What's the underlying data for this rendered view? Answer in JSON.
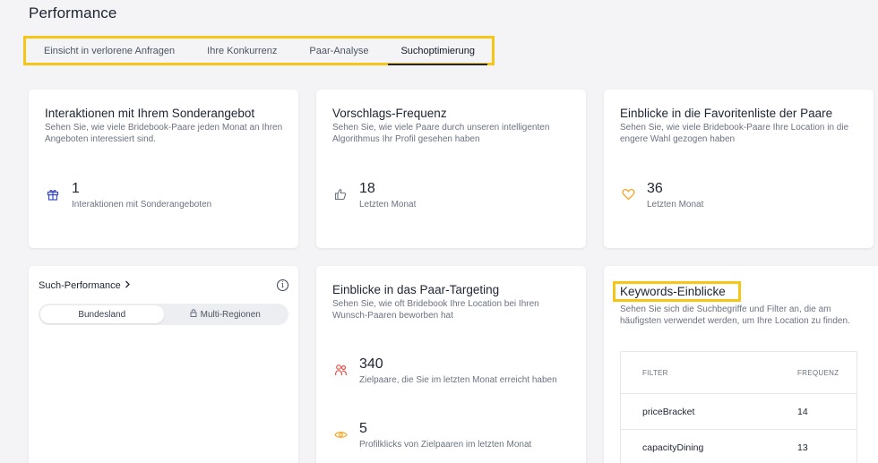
{
  "page": {
    "title": "Performance"
  },
  "tabs": [
    {
      "label": "Einsicht in verlorene Anfragen"
    },
    {
      "label": "Ihre Konkurrenz"
    },
    {
      "label": "Paar-Analyse"
    },
    {
      "label": "Suchoptimierung"
    }
  ],
  "cards": {
    "offer": {
      "title": "Interaktionen mit Ihrem Sonderangebot",
      "description": "Sehen Sie, wie viele Bridebook-Paare jeden Monat an Ihren Angeboten interessiert sind.",
      "metric_value": "1",
      "metric_caption": "Interaktionen mit Sonderangeboten",
      "icon": "gift-icon"
    },
    "suggestions": {
      "title": "Vorschlags-Frequenz",
      "description": "Sehen Sie, wie viele Paare durch unseren intelligenten Algorithmus Ihr Profil gesehen haben",
      "metric_value": "18",
      "metric_caption": "Letzten Monat",
      "icon": "thumbs-up-icon"
    },
    "favorites": {
      "title": "Einblicke in die Favoritenliste der Paare",
      "description": "Sehen Sie, wie viele Bridebook-Paare Ihre Location in die engere Wahl gezogen haben",
      "metric_value": "36",
      "metric_caption": "Letzten Monat",
      "icon": "heart-icon"
    },
    "search_performance": {
      "title": "Such-Performance",
      "info_icon": "i",
      "toggle": [
        {
          "label": "Bundesland"
        },
        {
          "label": "Multi-Regionen"
        }
      ]
    },
    "targeting": {
      "title": "Einblicke in das Paar-Targeting",
      "description": "Sehen Sie, wie oft Bridebook Ihre Location bei Ihren Wunsch-Paaren beworben hat",
      "metrics": [
        {
          "value": "340",
          "caption": "Zielpaare, die Sie im letzten Monat erreicht haben",
          "icon": "couple-icon"
        },
        {
          "value": "5",
          "caption": "Profilklicks von Zielpaaren im letzten Monat",
          "icon": "eye-icon"
        }
      ]
    },
    "keywords": {
      "title": "Keywords-Einblicke",
      "description": "Sehen Sie sich die Suchbegriffe und Filter an, die am häufigsten verwendet werden, um Ihre Location zu finden.",
      "columns": {
        "filter": "FILTER",
        "frequency": "FREQUENZ"
      },
      "rows": [
        {
          "filter": "priceBracket",
          "frequency": "14"
        },
        {
          "filter": "capacityDining",
          "frequency": "13"
        }
      ]
    }
  },
  "colors": {
    "highlight": "#f5c518",
    "accent_icon": "#3b4bc8",
    "heart": "#f5a623",
    "couple": "#e5534b",
    "eye": "#f5a623"
  }
}
